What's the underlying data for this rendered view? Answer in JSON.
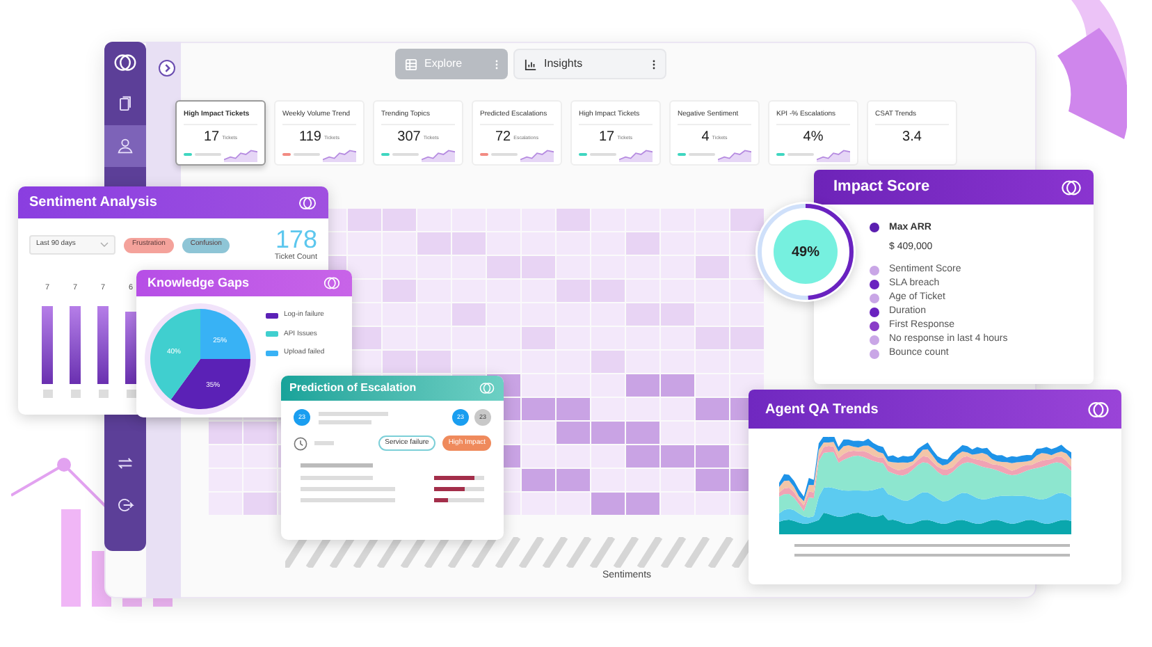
{
  "sidebar": {
    "items": [
      {
        "kind": "docs",
        "selected": false
      },
      {
        "kind": "person",
        "selected": true
      }
    ],
    "bottom_items": [
      {
        "kind": "swap",
        "selected": false
      },
      {
        "kind": "logout",
        "selected": false
      }
    ]
  },
  "view_tabs": [
    {
      "label": "Explore",
      "selected": true
    },
    {
      "label": "Insights",
      "selected": false
    }
  ],
  "kpi_cards": [
    {
      "title": "High Impact Tickets",
      "value": "17",
      "unit": "Tickets",
      "color": "#3fd6c0",
      "selected": true
    },
    {
      "title": "Weekly Volume Trend",
      "value": "119",
      "unit": "Tickets",
      "color": "#f28b82",
      "selected": false
    },
    {
      "title": "Trending Topics",
      "value": "307",
      "unit": "Tickets",
      "color": "#3fd6c0",
      "selected": false
    },
    {
      "title": "Predicted Escalations",
      "value": "72",
      "unit": "Escalations",
      "color": "#f28b82",
      "selected": false
    },
    {
      "title": "High Impact Tickets",
      "value": "17",
      "unit": "Tickets",
      "color": "#3fd6c0",
      "selected": false
    },
    {
      "title": "Negative Sentiment",
      "value": "4",
      "unit": "Tickets",
      "color": "#3fd6c0",
      "selected": false
    },
    {
      "title": "KPI -% Escalations",
      "value": "4%",
      "color": "#3fd6c0",
      "selected": false
    },
    {
      "title": "CSAT Trends",
      "value": "3.4",
      "selected": false
    }
  ],
  "heatmap": {
    "xlabel": "Sentiments"
  },
  "sentiment_analysis": {
    "title": "Sentiment Analysis",
    "filter": "Last 90 days",
    "tags": [
      {
        "label": "Frustration",
        "color": "#f4a29b"
      },
      {
        "label": "Confusion",
        "color": "#8ec5d6"
      }
    ],
    "count": "178",
    "count_label": "Ticket Count",
    "bars": [
      {
        "label": "7"
      },
      {
        "label": "7"
      },
      {
        "label": "7"
      },
      {
        "label": "6"
      }
    ]
  },
  "knowledge_gaps": {
    "title": "Knowledge Gaps",
    "chart_data": {
      "type": "pie",
      "categories": [
        "Log-in failure",
        "API Issues",
        "Upload failed"
      ],
      "values": [
        35,
        40,
        25
      ],
      "colors": [
        "#5b21b6",
        "#40cfcf",
        "#38b2f5"
      ],
      "value_labels": [
        "35%",
        "40%",
        "25%"
      ]
    }
  },
  "prediction": {
    "title": "Prediction of Escalation",
    "badge": "23",
    "counters": [
      {
        "label": "23",
        "selected": true
      },
      {
        "label": "23",
        "selected": false
      }
    ],
    "tags": [
      {
        "label": "Service failure",
        "kind": "outline"
      },
      {
        "label": "High Impact",
        "kind": "filled"
      }
    ],
    "bars": [
      {
        "level": 0.8
      },
      {
        "level": 0.6
      },
      {
        "level": 0.28
      }
    ]
  },
  "impact_score": {
    "title": "Impact Score",
    "score": "49%",
    "level": 0.49,
    "headline": {
      "label": "Max ARR",
      "value": "$ 409,000",
      "color": "#5b1fb0"
    },
    "factors": [
      {
        "label": "Sentiment Score",
        "color": "#c9a6e6"
      },
      {
        "label": "SLA breach",
        "color": "#6a22c0"
      },
      {
        "label": "Age of Ticket",
        "color": "#c9a6e6"
      },
      {
        "label": "Duration",
        "color": "#6a22c0"
      },
      {
        "label": "First Response",
        "color": "#8a3cc8"
      },
      {
        "label": "No response in last 4 hours",
        "color": "#c9a6e6"
      },
      {
        "label": "Bounce count",
        "color": "#c9a6e6"
      }
    ]
  },
  "agent_qa": {
    "title": "Agent QA Trends"
  }
}
